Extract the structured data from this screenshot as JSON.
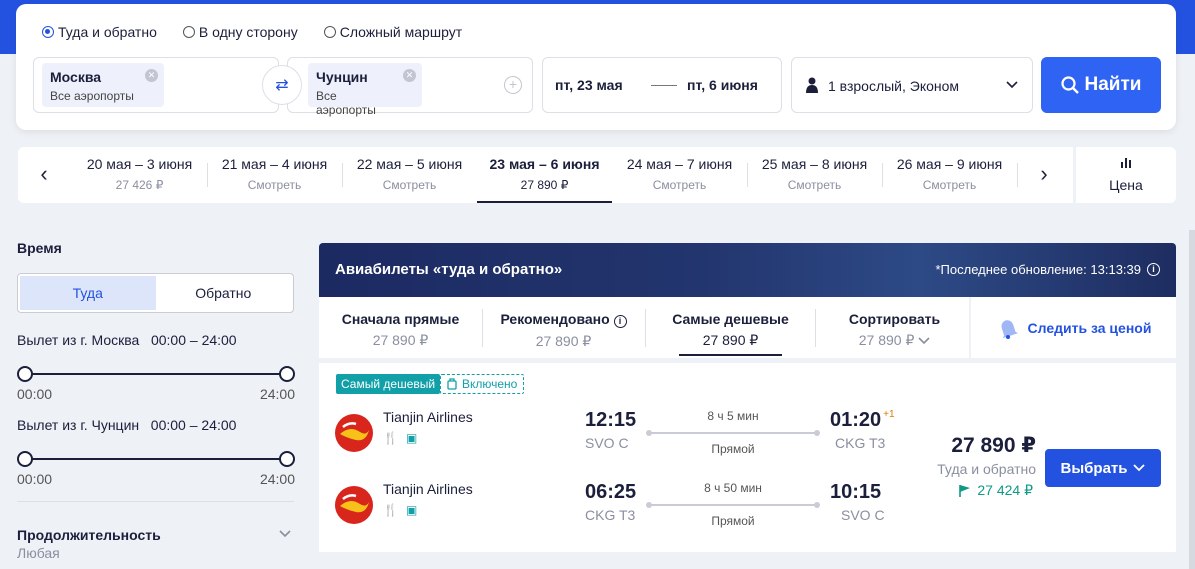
{
  "search": {
    "trip_types": [
      {
        "label": "Туда и обратно",
        "selected": true
      },
      {
        "label": "В одну сторону",
        "selected": false
      },
      {
        "label": "Сложный маршрут",
        "selected": false
      }
    ],
    "origin": {
      "city": "Москва",
      "sub": "Все аэропорты"
    },
    "destination": {
      "city": "Чунцин",
      "sub": "Все аэропорты"
    },
    "date_from": "пт, 23 мая",
    "date_to": "пт, 6 июня",
    "passengers": "1 взрослый, Эконом",
    "find_label": "Найти"
  },
  "date_strip": [
    {
      "range": "20 мая – 3 июня",
      "price": "27 426 ₽",
      "active": false
    },
    {
      "range": "21 мая – 4 июня",
      "price": "Смотреть",
      "active": false
    },
    {
      "range": "22 мая – 5 июня",
      "price": "Смотреть",
      "active": false
    },
    {
      "range": "23 мая – 6 июня",
      "price": "27 890 ₽",
      "active": true
    },
    {
      "range": "24 мая – 7 июня",
      "price": "Смотреть",
      "active": false
    },
    {
      "range": "25 мая – 8 июня",
      "price": "Смотреть",
      "active": false
    },
    {
      "range": "26 мая – 9 июня",
      "price": "Смотреть",
      "active": false
    }
  ],
  "price_chart_label": "Цена",
  "filters": {
    "time_title": "Время",
    "dir_tabs": [
      {
        "label": "Туда",
        "selected": true
      },
      {
        "label": "Обратно",
        "selected": false
      }
    ],
    "dep1_label": "Вылет из г. Москва   00:00 – 24:00",
    "dep2_label": "Вылет из г. Чунцин   00:00 – 24:00",
    "range_min": "00:00",
    "range_max": "24:00",
    "duration_title": "Продолжительность",
    "duration_value": "Любая"
  },
  "results": {
    "title": "Авиабилеты «туда и обратно»",
    "updated": "*Последнее обновление: 13:13:39",
    "sorts": [
      {
        "label": "Сначала прямые",
        "price": "27 890 ₽",
        "active": false
      },
      {
        "label": "Рекомендовано",
        "price": "27 890 ₽",
        "active": false,
        "info": true
      },
      {
        "label": "Самые дешевые",
        "price": "27 890 ₽",
        "active": true
      },
      {
        "label": "Сортировать",
        "price": "27 890 ₽",
        "active": false,
        "dropdown": true
      }
    ],
    "follow_label": "Следить за ценой"
  },
  "ticket": {
    "badge_cheapest": "Самый дешевый",
    "badge_included": "Включено",
    "segments": [
      {
        "airline": "Tianjin Airlines",
        "dep_time": "12:15",
        "dep_airport": "SVO C",
        "duration": "8 ч 5 мин",
        "stops": "Прямой",
        "arr_time": "01:20",
        "arr_plus": "+1",
        "arr_airport": "CKG T3"
      },
      {
        "airline": "Tianjin Airlines",
        "dep_time": "06:25",
        "dep_airport": "CKG T3",
        "duration": "8 ч 50 мин",
        "stops": "Прямой",
        "arr_time": "10:15",
        "arr_plus": "",
        "arr_airport": "SVO C"
      }
    ],
    "price": "27 890 ₽",
    "price_sub": "Туда и обратно",
    "price_alt": "27 424 ₽",
    "choose_label": "Выбрать"
  },
  "colors": {
    "brand": "#2452e0",
    "teal": "#12a0a8",
    "green": "#0f9a84",
    "airline_red": "#d9261c"
  }
}
